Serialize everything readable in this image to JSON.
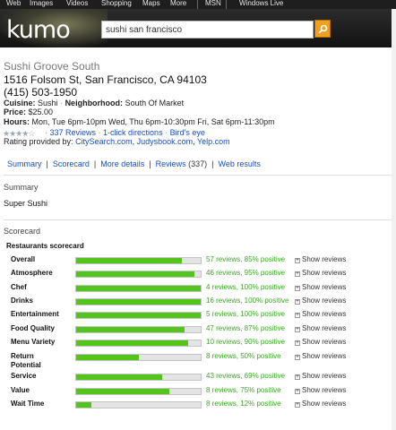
{
  "topnav": {
    "items": [
      "Web",
      "Images",
      "Videos",
      "Shopping",
      "Maps",
      "More",
      "MSN",
      "Windows Live"
    ]
  },
  "header": {
    "logo": "kumo",
    "search_value": "sushi san francisco"
  },
  "business": {
    "name": "Sushi Groove South",
    "address": "1516 Folsom St, San Francisco, CA 94103",
    "phone": "(415) 503-1950",
    "cuisine_label": "Cuisine:",
    "cuisine": "Sushi",
    "neighborhood_label": "Neighborhood:",
    "neighborhood": "South Of Market",
    "price_label": "Price:",
    "price": "$25.00",
    "hours_label": "Hours:",
    "hours": "Mon, Tue 6pm-10pm Wed, Thu 6pm-10:30pm Fri, Sat 6pm-11:30pm",
    "stars": "★★★★☆",
    "reviews_link": "337 Reviews",
    "directions_link": "1-click directions",
    "birdseye_link": "Bird's eye",
    "rating_by_label": "Rating provided by:",
    "providers": [
      "CitySearch.com",
      "Judysbook.com",
      "Yelp.com"
    ]
  },
  "tabs": [
    {
      "label": "Summary"
    },
    {
      "label": "Scorecard"
    },
    {
      "label": "More details"
    },
    {
      "label": "Reviews",
      "count": "(337)"
    },
    {
      "label": "Web results"
    }
  ],
  "summary": {
    "title": "Summary",
    "text": "Super Sushi"
  },
  "scorecard": {
    "title": "Scorecard",
    "subtitle": "Restaurants scorecard",
    "show_label": "Show reviews",
    "rows": [
      {
        "label": "Overall",
        "stat": "57 reviews, 85% positive",
        "fraction": 0.85
      },
      {
        "label": "Atmosphere",
        "stat": "46 reviews, 95% positive",
        "fraction": 0.95
      },
      {
        "label": "Chef",
        "stat": "4 reviews, 100% positive",
        "fraction": 1.0
      },
      {
        "label": "Drinks",
        "stat": "16 reviews, 100% positive",
        "fraction": 1.0
      },
      {
        "label": "Entertainment",
        "stat": "5 reviews, 100% positive",
        "fraction": 1.0
      },
      {
        "label": "Food Quality",
        "stat": "47 reviews, 87% positive",
        "fraction": 0.87
      },
      {
        "label": "Menu Variety",
        "stat": "10 reviews, 90% positive",
        "fraction": 0.9
      },
      {
        "label": "Return Potential",
        "stat": "8 reviews, 50% positive",
        "fraction": 0.5
      },
      {
        "label": "Service",
        "stat": "43 reviews, 69% positive",
        "fraction": 0.69
      },
      {
        "label": "Value",
        "stat": "8 reviews, 75% positive",
        "fraction": 0.75
      },
      {
        "label": "Wait Time",
        "stat": "8 reviews, 12% positive",
        "fraction": 0.12
      }
    ]
  },
  "colors": {
    "bar_fill": "#52c41a",
    "stat_text": "#3aa822",
    "link": "#1a4ebf",
    "search_button": "#f0a020"
  }
}
